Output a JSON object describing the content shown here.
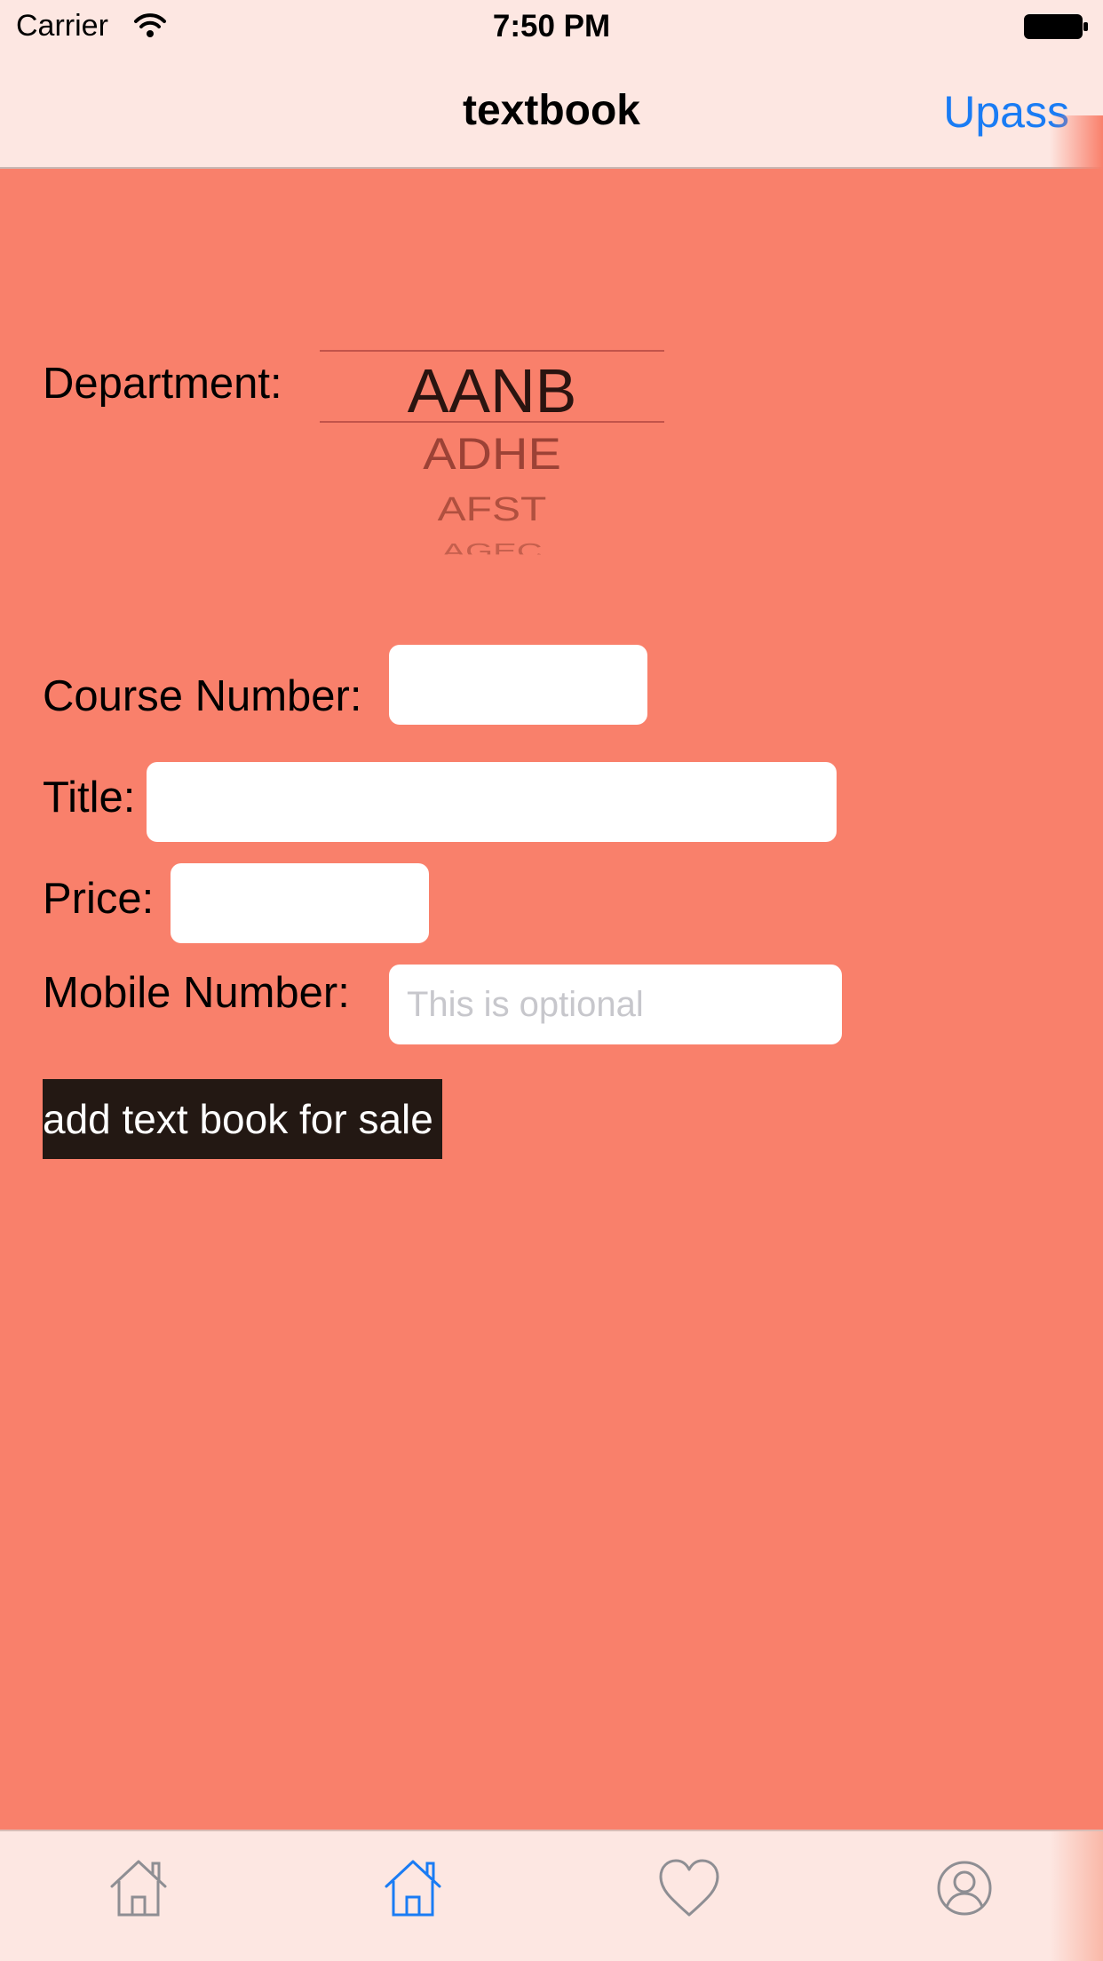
{
  "status_bar": {
    "carrier": "Carrier",
    "time": "7:50 PM"
  },
  "nav": {
    "title": "textbook",
    "right_button": "Upass"
  },
  "form": {
    "department_label": "Department:",
    "department_picker": {
      "selected": "AANB",
      "options": [
        "AANB",
        "ADHE",
        "AFST",
        "AGEC"
      ]
    },
    "course_number_label": "Course Number:",
    "course_number_value": "",
    "title_label": "Title:",
    "title_value": "",
    "price_label": "Price:",
    "price_value": "",
    "mobile_label": "Mobile Number:",
    "mobile_placeholder": "This is optional",
    "submit_label": "add text book for sale"
  },
  "tabbar": {
    "items": [
      {
        "icon": "home-icon",
        "active": false
      },
      {
        "icon": "home-icon",
        "active": true
      },
      {
        "icon": "heart-icon",
        "active": false
      },
      {
        "icon": "profile-icon",
        "active": false
      }
    ]
  },
  "colors": {
    "background": "#f9806b",
    "bar_background": "#fde7e2",
    "accent": "#1a7cf4",
    "button_background": "#231813",
    "inactive_icon": "#8e8e93"
  }
}
